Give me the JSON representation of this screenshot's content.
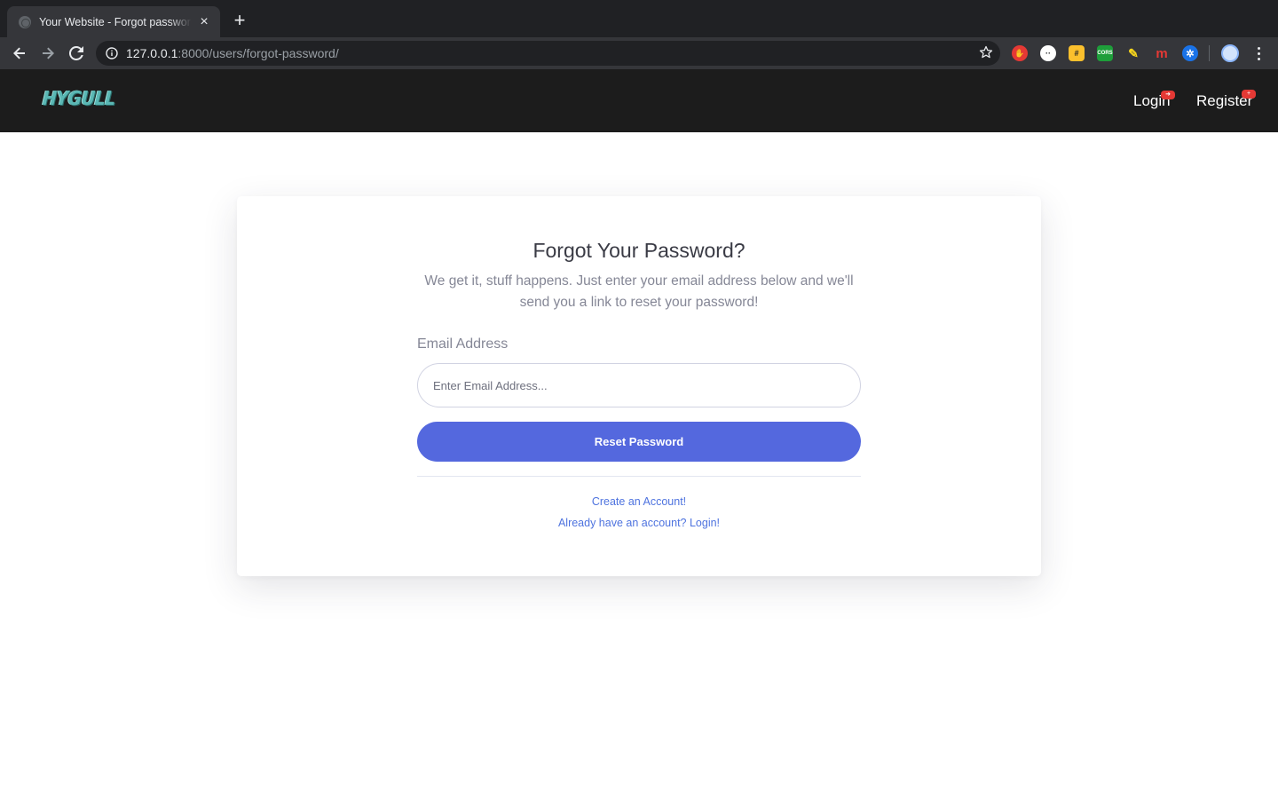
{
  "browser": {
    "tab_title": "Your Website - Forgot password",
    "tab_close": "×",
    "new_tab": "+",
    "url_host": "127.0.0.1",
    "url_rest": ":8000/users/forgot-password/",
    "extensions": [
      {
        "icon": "hand-stop-icon",
        "color": "#e53935",
        "glyph": "✋"
      },
      {
        "icon": "circle-dots-icon",
        "color": "#ffffff",
        "glyph": "⊙"
      },
      {
        "icon": "hashtag-note-icon",
        "color": "#fbc02d",
        "glyph": "#"
      },
      {
        "icon": "cors-icon",
        "color": "#1e9e3a",
        "glyph": "CORS"
      },
      {
        "icon": "highlighter-icon",
        "color": "#f9d71c",
        "glyph": "✎"
      },
      {
        "icon": "m-logo-icon",
        "color": "#e53935",
        "glyph": "m"
      },
      {
        "icon": "puzzle-blue-icon",
        "color": "#1a73e8",
        "glyph": "✲"
      }
    ]
  },
  "navbar": {
    "logo": "HYGULL",
    "login": "Login",
    "register": "Register",
    "login_badge_icon": "sign-in-icon",
    "register_badge_icon": "user-plus-icon"
  },
  "form": {
    "title": "Forgot Your Password?",
    "description": "We get it, stuff happens. Just enter your email address below and we'll send you a link to reset your password!",
    "email_label": "Email Address",
    "email_placeholder": "Enter Email Address...",
    "email_value": "",
    "submit_label": "Reset Password",
    "create_account_link": "Create an Account!",
    "login_link": "Already have an account? Login!"
  },
  "colors": {
    "primary_button": "#5468de",
    "link": "#4e73df",
    "navbar_bg": "#1c1c1c",
    "logo": "#5ab7b4"
  }
}
